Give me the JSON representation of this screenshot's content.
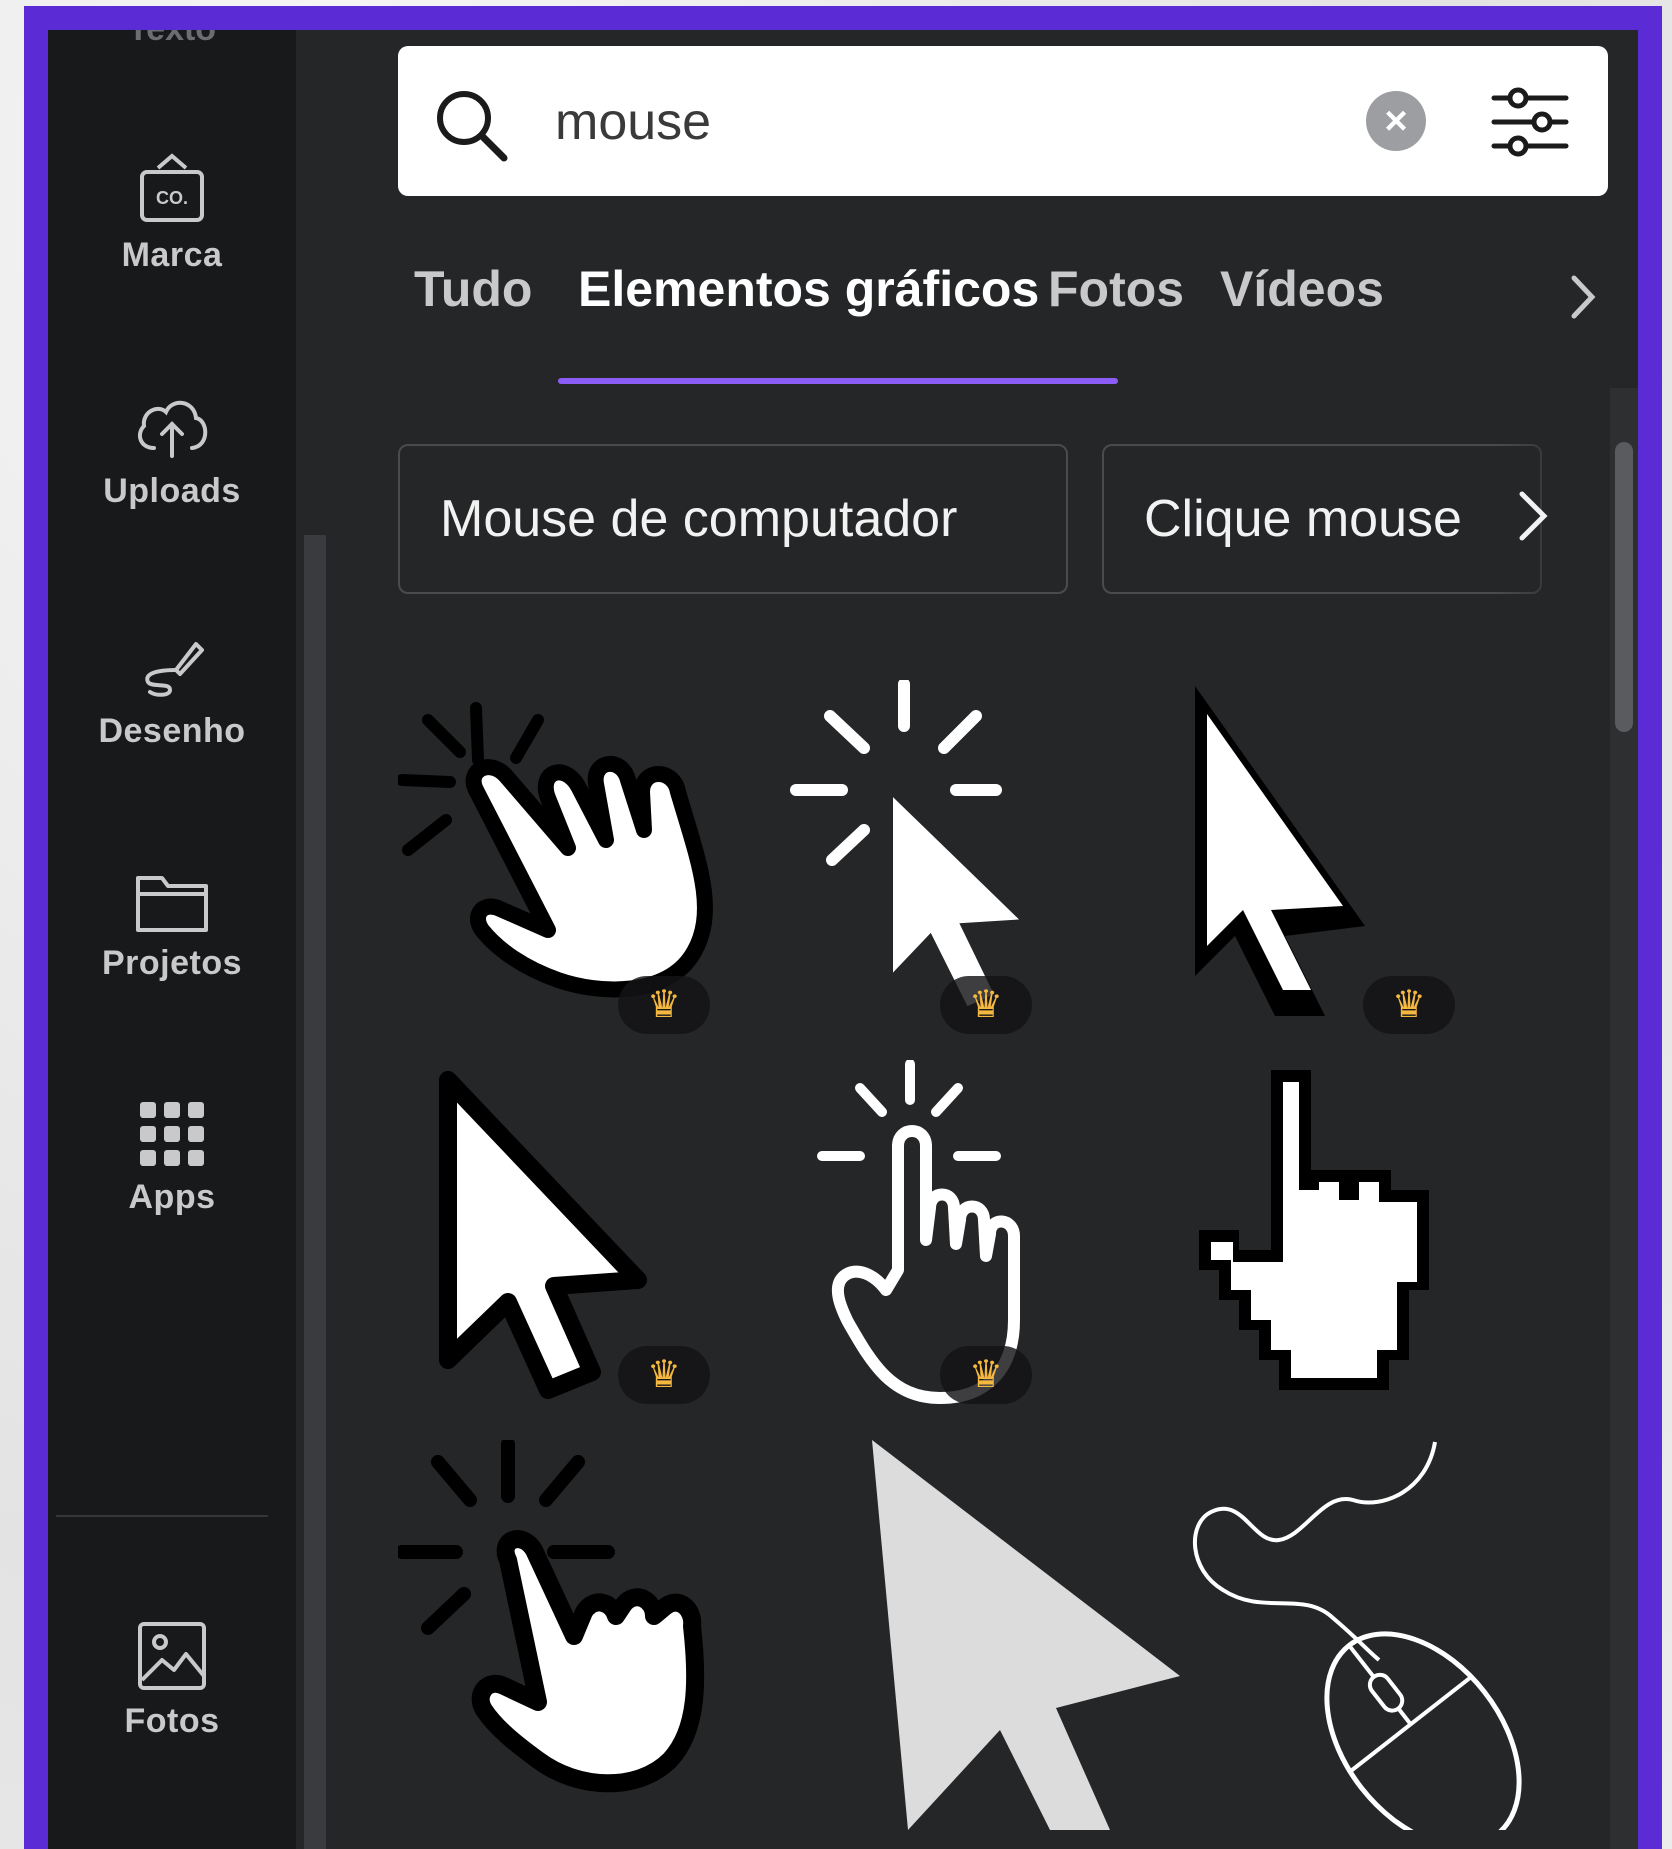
{
  "sidebar": {
    "cut_label": "Texto",
    "items": [
      {
        "label": "Marca",
        "icon": "brand-kit-icon"
      },
      {
        "label": "Uploads",
        "icon": "cloud-upload-icon"
      },
      {
        "label": "Desenho",
        "icon": "draw-icon"
      },
      {
        "label": "Projetos",
        "icon": "folder-icon"
      },
      {
        "label": "Apps",
        "icon": "apps-grid-icon"
      },
      {
        "label": "Fotos",
        "icon": "photos-icon"
      }
    ],
    "brand_badge": "CO."
  },
  "search": {
    "value": "mouse",
    "placeholder": "",
    "clear_icon": "clear-icon",
    "filter_icon": "filter-sliders-icon"
  },
  "tabs": [
    {
      "label": "Tudo",
      "active": false
    },
    {
      "label": "Elementos gráficos",
      "active": true
    },
    {
      "label": "Fotos",
      "active": false
    },
    {
      "label": "Vídeos",
      "active": false
    }
  ],
  "suggestions": [
    "Mouse de computador",
    "Clique mouse"
  ],
  "results": [
    {
      "name": "hand-click-icon",
      "premium": true
    },
    {
      "name": "arrow-click-icon",
      "premium": true
    },
    {
      "name": "pixel-arrow-icon",
      "premium": true
    },
    {
      "name": "arrow-cursor-icon",
      "premium": true
    },
    {
      "name": "outline-hand-click-icon",
      "premium": true
    },
    {
      "name": "pixel-hand-icon",
      "premium": false
    },
    {
      "name": "hand-tap-icon",
      "premium": false
    },
    {
      "name": "gray-arrow-icon",
      "premium": false
    },
    {
      "name": "computer-mouse-icon",
      "premium": false
    }
  ],
  "colors": {
    "frame": "#5b2bd6",
    "panel": "#252627",
    "sidebar": "#18191b",
    "accent": "#8b5cf6",
    "crown": "#f4b740"
  }
}
